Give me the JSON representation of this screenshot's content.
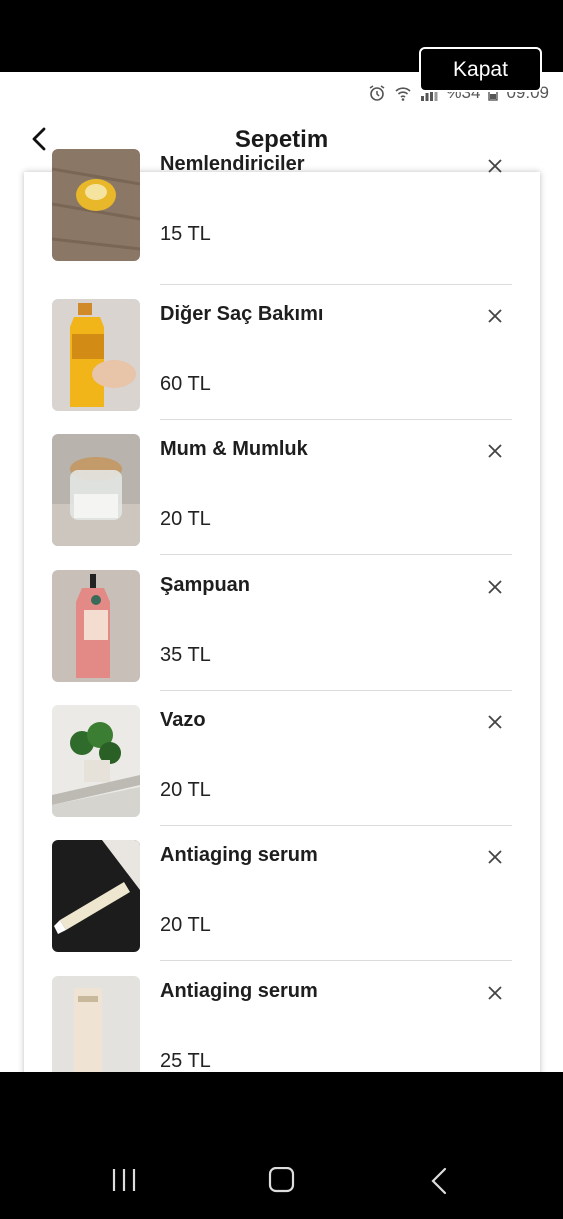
{
  "overlay": {
    "close_label": "Kapat"
  },
  "status_bar": {
    "time": "09:09",
    "battery": "%34"
  },
  "header": {
    "title": "Sepetim"
  },
  "cart": {
    "items": [
      {
        "name": "Nemlendiriciler",
        "price": "15 TL",
        "thumb": "cream-jar"
      },
      {
        "name": "Diğer Saç Bakımı",
        "price": "60 TL",
        "thumb": "hair-oil-bottle"
      },
      {
        "name": "Mum & Mumluk",
        "price": "20 TL",
        "thumb": "candle-jar"
      },
      {
        "name": "Şampuan",
        "price": "35 TL",
        "thumb": "shampoo-bottle"
      },
      {
        "name": "Vazo",
        "price": "20 TL",
        "thumb": "plant-vase"
      },
      {
        "name": "Antiaging serum",
        "price": "20 TL",
        "thumb": "serum-tube"
      },
      {
        "name": "Antiaging serum",
        "price": "25 TL",
        "thumb": "serum-bottle"
      }
    ]
  },
  "icons": {
    "back": "chevron-left-icon",
    "remove": "close-icon",
    "nav_recents": "recents-icon",
    "nav_home": "home-icon",
    "nav_back": "back-icon"
  },
  "colors": {
    "background": "#ffffff",
    "text": "#1e1e1e",
    "divider": "#dcdcdc"
  }
}
